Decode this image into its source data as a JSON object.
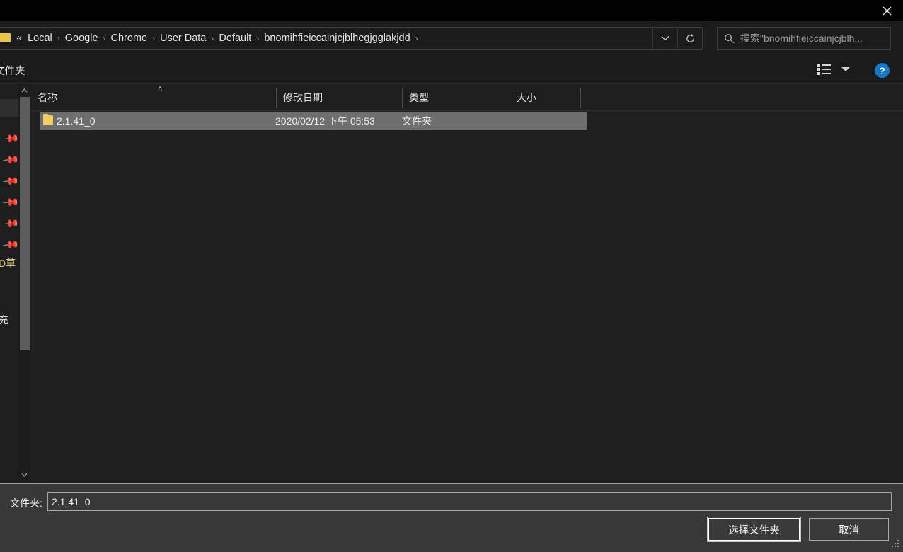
{
  "window": {
    "close_label": "✕"
  },
  "address": {
    "ellipsis": "«",
    "crumbs": [
      "Local",
      "Google",
      "Chrome",
      "User Data",
      "Default",
      "bnomihfieiccainjcjblhegjgglakjdd"
    ],
    "separator": "›",
    "history_icon": "chevron-down",
    "refresh_icon": "refresh"
  },
  "search": {
    "icon": "search-icon",
    "placeholder": "搜索\"bnomihfieiccainjcjblh...",
    "value": ""
  },
  "toolbar": {
    "new_folder_label": "文件夹",
    "view_icon": "view-details-icon",
    "view_caret": "chevron-down-icon",
    "help_label": "?"
  },
  "sidebar": {
    "items": [
      {
        "label": "",
        "icon": "pin-icon",
        "selected": true
      },
      {
        "label": "",
        "icon": "pin-icon",
        "selected": false
      },
      {
        "label": "",
        "icon": "pin-icon",
        "selected": false
      },
      {
        "label": "",
        "icon": "pin-icon",
        "selected": false
      },
      {
        "label": "",
        "icon": "pin-icon",
        "selected": false
      },
      {
        "label": "",
        "icon": "pin-icon",
        "selected": false
      },
      {
        "label": "",
        "icon": "pin-icon",
        "selected": false
      },
      {
        "label": "D草",
        "icon": "cloud-icon",
        "selected": false
      },
      {
        "label": "充",
        "icon": "pc-icon",
        "selected": false
      }
    ],
    "scroll_up": "▲",
    "scroll_down": "▼"
  },
  "list": {
    "columns": [
      {
        "key": "name",
        "label": "名称",
        "sorted": "asc"
      },
      {
        "key": "date",
        "label": "修改日期",
        "sorted": ""
      },
      {
        "key": "type",
        "label": "类型",
        "sorted": ""
      },
      {
        "key": "size",
        "label": "大小",
        "sorted": ""
      }
    ],
    "sort_caret": "˄",
    "rows": [
      {
        "name": "2.1.41_0",
        "date": "2020/02/12 下午 05:53",
        "type": "文件夹",
        "size": "",
        "icon": "folder-icon",
        "selected": true
      }
    ]
  },
  "footer": {
    "folder_label": "文件夹:",
    "folder_value": "2.1.41_0",
    "folder_placeholder": "",
    "select_button": "选择文件夹",
    "cancel_button": "取消"
  },
  "colors": {
    "window_bg": "#1e1e1e",
    "list_bg": "#202020",
    "panel_bg": "#383838",
    "selection": "#6e6e6e",
    "folder_yellow": "#f0cf62",
    "help_blue": "#1579c8",
    "text": "#ededed"
  }
}
